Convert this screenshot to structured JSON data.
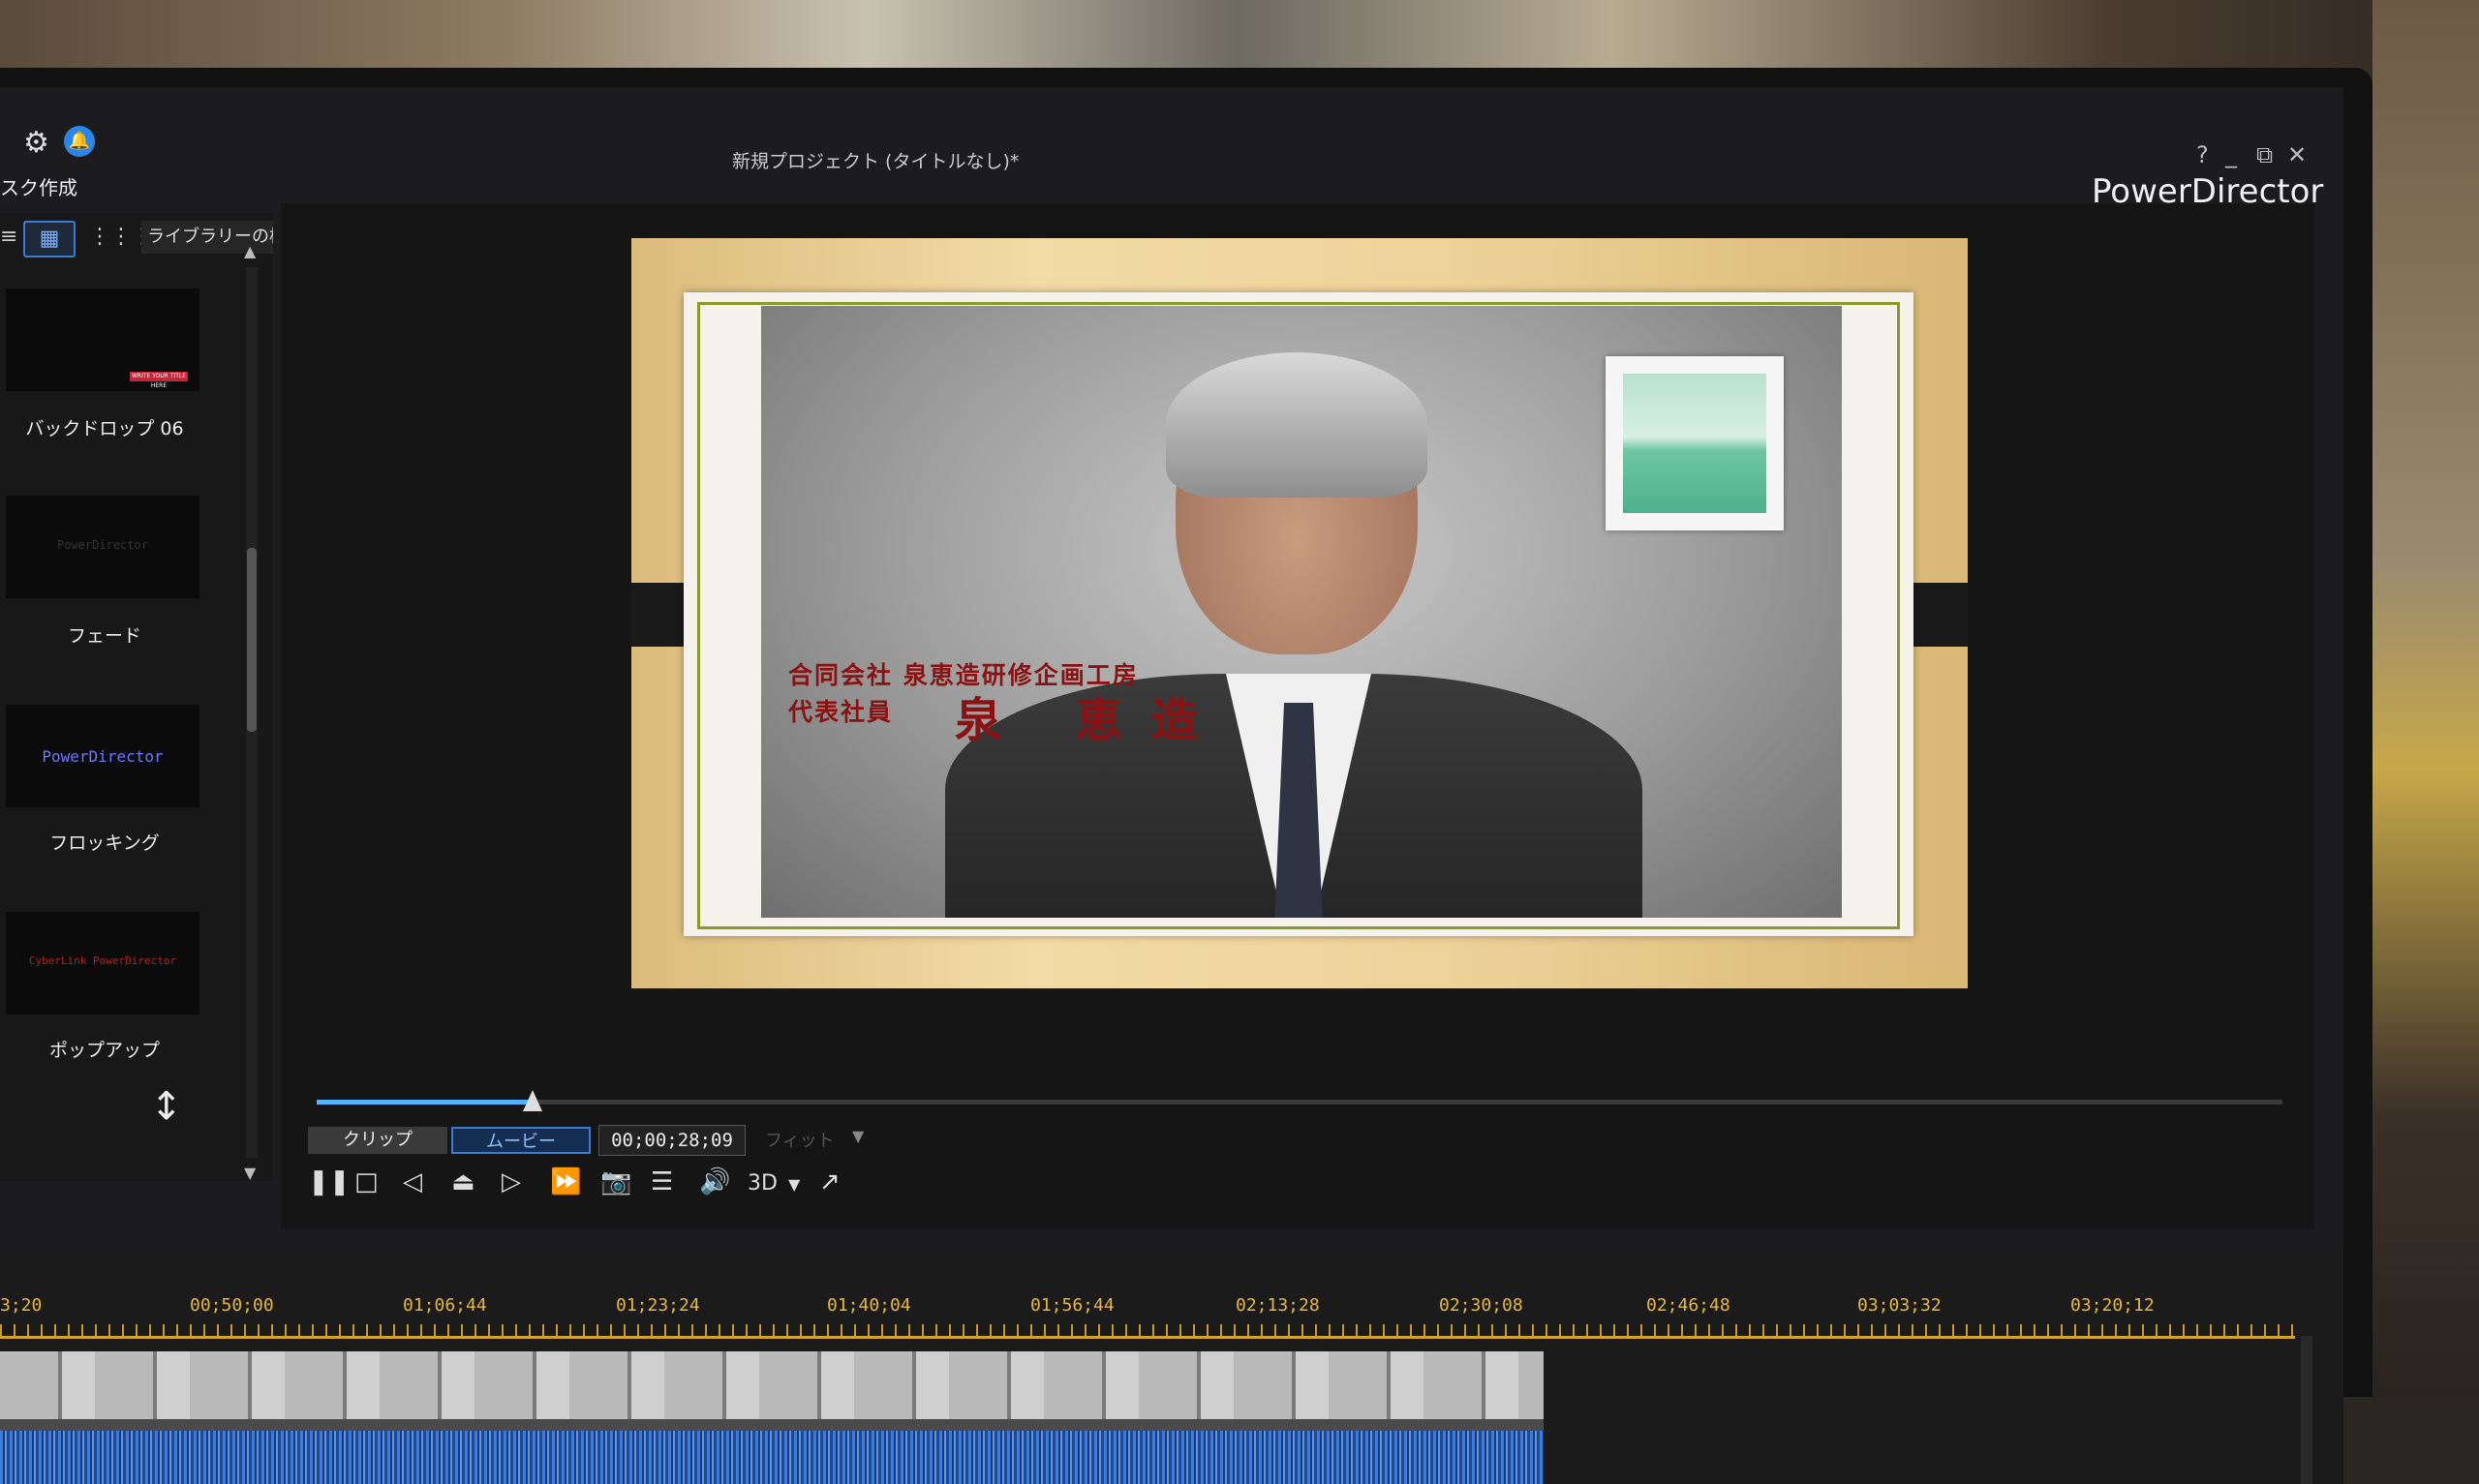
{
  "header": {
    "task_label": "スク作成",
    "project_title": "新規プロジェクト (タイトルなし)*",
    "brand": "PowerDirector",
    "help": "?",
    "minimize": "_",
    "restore": "⧉",
    "close": "✕"
  },
  "library": {
    "search_label": "ライブラリーの検索",
    "items": [
      {
        "label": "バックドロップ 06",
        "thumb_text": "WRITE YOUR TITLE HERE"
      },
      {
        "label": "フェード",
        "thumb_text": "PowerDirector"
      },
      {
        "label": "フロッキング",
        "thumb_text": "PowerDirector"
      },
      {
        "label": "ポップアップ",
        "thumb_text": "CyberLink PowerDirector"
      }
    ]
  },
  "preview": {
    "caption_line1": "合同会社 泉恵造研修企画工房",
    "caption_line2": "代表社員",
    "caption_name": "泉 恵造"
  },
  "playback": {
    "progress": 0.11,
    "mode_clip": "クリップ",
    "mode_movie": "ムービー",
    "timecode": "00;00;28;09",
    "fit": "フィット",
    "label_3d": "3D"
  },
  "timeline": {
    "ruler_labels": [
      "3;20",
      "00;50;00",
      "01;06;44",
      "01;23;24",
      "01;40;04",
      "01;56;44",
      "02;13;28",
      "02;30;08",
      "02;46;48",
      "03;03;32",
      "03;20;12"
    ]
  },
  "colors": {
    "accent": "#3a7bd5",
    "seek_fill": "#4fb3ff",
    "ruler": "#d4a52e",
    "caption": "#8a1212"
  }
}
